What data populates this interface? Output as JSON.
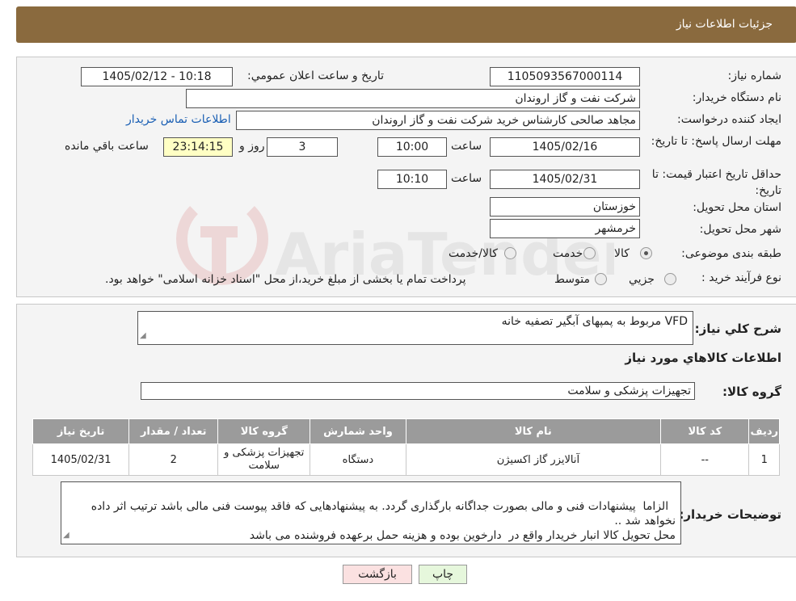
{
  "header": {
    "title": "جزئيات اطلاعات نياز"
  },
  "form": {
    "need_number_label": "شماره نياز:",
    "need_number": "1105093567000114",
    "announce_label": "تاريخ و ساعت اعلان عمومي:",
    "announce_value": "1405/02/12 - 10:18",
    "buyer_org_label": "نام دستگاه خريدار:",
    "buyer_org": "شرکت نفت و گاز اروندان",
    "creator_label": "ايجاد کننده درخواست:",
    "creator": "مجاهد صالحی کارشناس خرید شرکت نفت و گاز اروندان",
    "contact_link": "اطلاعات تماس خريدار",
    "deadline_label": "مهلت ارسال پاسخ: تا تاريخ:",
    "deadline_date": "1405/02/16",
    "time_label": "ساعت",
    "deadline_time": "10:00",
    "days": "3",
    "days_label": "روز و",
    "remaining_time": "23:14:15",
    "remaining_label": "ساعت باقي مانده",
    "validity_label": "حداقل تاريخ اعتبار قيمت: تا تاريخ:",
    "validity_date": "1405/02/31",
    "validity_time": "10:10",
    "province_label": "استان محل تحويل:",
    "province": "خوزستان",
    "city_label": "شهر محل تحويل:",
    "city": "خرمشهر",
    "category_label": "طبقه بندی موضوعی:",
    "category_options": [
      "کالا",
      "خدمت",
      "کالا/خدمت"
    ],
    "category_selected": "کالا",
    "process_label": "نوع فرآيند خريد :",
    "process_options": [
      "جزيي",
      "متوسط"
    ],
    "process_note": "پرداخت تمام يا بخشی از مبلغ خريد،از محل \"اسناد خزانه اسلامی\" خواهد بود."
  },
  "summary": {
    "desc_label": "شرح کلي نياز:",
    "desc_value": "VFD  مربوط به پمپهای آبگیر تصفیه خانه",
    "goods_info_title": "اطلاعات کالاهاي مورد نياز",
    "goods_group_label": "گروه کالا:",
    "goods_group_value": "تجهیزات پزشکی و سلامت"
  },
  "table": {
    "headers": [
      "رديف",
      "کد کالا",
      "نام کالا",
      "واحد شمارش",
      "گروه کالا",
      "تعداد / مقدار",
      "تاريخ نياز"
    ],
    "rows": [
      [
        "1",
        "--",
        "آنالایزر گاز اکسیژن",
        "دستگاه",
        "تجهیزات پزشکی و سلامت",
        "2",
        "1405/02/31"
      ]
    ]
  },
  "buyer_notes": {
    "label": "توضيحات خريدار:",
    "text": "الزاما  پیشنهادات فنی و مالی بصورت جداگانه بارگذاری گردد. به پیشنهادهایی که فاقد پیوست فنی مالی باشد ترتیب اثر داده نخواهد شد ..\nمحل تحویل کالا انبار خریدار واقع در  دارخوین بوده و هزینه حمل برعهده فروشنده می باشد"
  },
  "buttons": {
    "print": "چاپ",
    "back": "بازگشت"
  },
  "watermark": {
    "text": "AriaTender.neT"
  },
  "colors": {
    "header_bg": "#8a6a3e",
    "print_btn": "#e6f7dc",
    "back_btn": "#fbe1e1",
    "remaining_bg": "#ffffc4"
  }
}
